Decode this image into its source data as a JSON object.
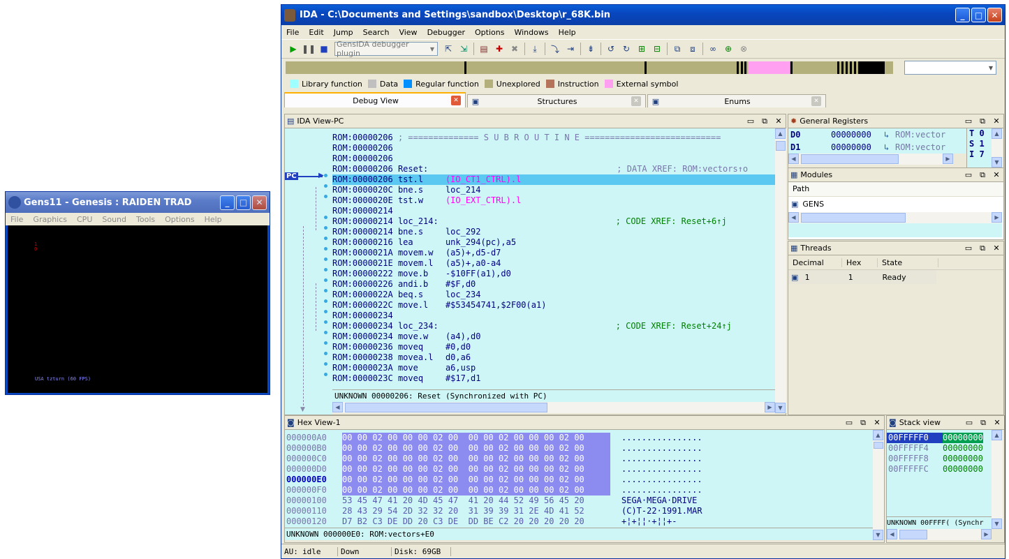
{
  "gens": {
    "title": "Gens11 - Genesis : RAIDEN TRAD",
    "menu": [
      "File",
      "Graphics",
      "CPU",
      "Sound",
      "Tools",
      "Options",
      "Help"
    ],
    "screen_text": "USA tzturn (60 FPS)",
    "sprite_text": "1\n0"
  },
  "ida": {
    "title": "IDA - C:\\Documents and Settings\\sandbox\\Desktop\\r_68K.bin",
    "menu": [
      "File",
      "Edit",
      "Jump",
      "Search",
      "View",
      "Debugger",
      "Options",
      "Windows",
      "Help"
    ],
    "debugger_select": "GensIDA debugger plugin",
    "legend": [
      {
        "label": "Library function",
        "color": "#a0ffff"
      },
      {
        "label": "Data",
        "color": "#c0c0c0"
      },
      {
        "label": "Regular function",
        "color": "#0090ff"
      },
      {
        "label": "Unexplored",
        "color": "#b3b07c"
      },
      {
        "label": "Instruction",
        "color": "#b4735a"
      },
      {
        "label": "External symbol",
        "color": "#ffa0f0"
      }
    ],
    "tabs": [
      {
        "label": "Debug View",
        "active": true
      },
      {
        "label": "Structures",
        "active": false
      },
      {
        "label": "Enums",
        "active": false
      }
    ],
    "idaview": {
      "title": "IDA View-PC",
      "pc_label": "PC",
      "status": "UNKNOWN 00000206: Reset (Synchronized with PC)",
      "lines": [
        {
          "a": "ROM:00000206",
          "m": "; ============== S U B R O U T I N E ===========================",
          "o": "",
          "c": ""
        },
        {
          "a": "ROM:00000206",
          "m": "",
          "o": "",
          "c": ""
        },
        {
          "a": "ROM:00000206",
          "m": "",
          "o": "",
          "c": ""
        },
        {
          "a": "ROM:00000206",
          "m": "Reset:",
          "o": "",
          "c": "; DATA XREF: ROM:vectors↑o"
        },
        {
          "a": "ROM:00000206",
          "m": "tst.l",
          "o": "(IO_CT1_CTRL).l",
          "c": ""
        },
        {
          "a": "ROM:0000020C",
          "m": "bne.s",
          "o": "loc_214",
          "c": ""
        },
        {
          "a": "ROM:0000020E",
          "m": "tst.w",
          "o": "(IO_EXT_CTRL).l",
          "c": ""
        },
        {
          "a": "ROM:00000214",
          "m": "",
          "o": "",
          "c": ""
        },
        {
          "a": "ROM:00000214",
          "m": "loc_214:",
          "o": "",
          "c": "; CODE XREF: Reset+6↑j"
        },
        {
          "a": "ROM:00000214",
          "m": "bne.s",
          "o": "loc_292",
          "c": ""
        },
        {
          "a": "ROM:00000216",
          "m": "lea",
          "o": "unk_294(pc),a5",
          "c": ""
        },
        {
          "a": "ROM:0000021A",
          "m": "movem.w",
          "o": "(a5)+,d5-d7",
          "c": ""
        },
        {
          "a": "ROM:0000021E",
          "m": "movem.l",
          "o": "(a5)+,a0-a4",
          "c": ""
        },
        {
          "a": "ROM:00000222",
          "m": "move.b",
          "o": "-$10FF(a1),d0",
          "c": ""
        },
        {
          "a": "ROM:00000226",
          "m": "andi.b",
          "o": "#$F,d0",
          "c": ""
        },
        {
          "a": "ROM:0000022A",
          "m": "beq.s",
          "o": "loc_234",
          "c": ""
        },
        {
          "a": "ROM:0000022C",
          "m": "move.l",
          "o": "#$53454741,$2F00(a1)",
          "c": ""
        },
        {
          "a": "ROM:00000234",
          "m": "",
          "o": "",
          "c": ""
        },
        {
          "a": "ROM:00000234",
          "m": "loc_234:",
          "o": "",
          "c": "; CODE XREF: Reset+24↑j"
        },
        {
          "a": "ROM:00000234",
          "m": "move.w",
          "o": "(a4),d0",
          "c": ""
        },
        {
          "a": "ROM:00000236",
          "m": "moveq",
          "o": "#0,d0",
          "c": ""
        },
        {
          "a": "ROM:00000238",
          "m": "movea.l",
          "o": "d0,a6",
          "c": ""
        },
        {
          "a": "ROM:0000023A",
          "m": "move",
          "o": "a6,usp",
          "c": ""
        },
        {
          "a": "ROM:0000023C",
          "m": "moveq",
          "o": "#$17,d1",
          "c": ""
        }
      ]
    },
    "registers": {
      "title": "General Registers",
      "rows": [
        {
          "name": "D0",
          "value": "00000000",
          "ref": "ROM:vector"
        },
        {
          "name": "D1",
          "value": "00000000",
          "ref": "ROM:vector"
        }
      ],
      "flags": [
        "T 0",
        "S 1",
        "I 7"
      ]
    },
    "modules": {
      "title": "Modules",
      "col": "Path",
      "item": "GENS"
    },
    "threads": {
      "title": "Threads",
      "cols": [
        "Decimal",
        "Hex",
        "State"
      ],
      "row": [
        "1",
        "1",
        "Ready"
      ]
    },
    "hex": {
      "title": "Hex View-1",
      "status": "UNKNOWN 000000E0: ROM:vectors+E0",
      "rows": [
        {
          "a": "000000A0",
          "b": "00 00 02 00 00 00 02 00  00 00 02 00 00 00 02 00",
          "t": "................",
          "sel": true
        },
        {
          "a": "000000B0",
          "b": "00 00 02 00 00 00 02 00  00 00 02 00 00 00 02 00",
          "t": "................",
          "sel": true
        },
        {
          "a": "000000C0",
          "b": "00 00 02 00 00 00 02 00  00 00 02 00 00 00 02 00",
          "t": "................",
          "sel": true
        },
        {
          "a": "000000D0",
          "b": "00 00 02 00 00 00 02 00  00 00 02 00 00 00 02 00",
          "t": "................",
          "sel": true
        },
        {
          "a": "000000E0",
          "b": "00 00 02 00 00 00 02 00  00 00 02 00 00 00 02 00",
          "t": "................",
          "sel": true
        },
        {
          "a": "000000F0",
          "b": "00 00 02 00 00 00 02 00  00 00 02 00 00 00 02 00",
          "t": "................",
          "sel": true
        },
        {
          "a": "00000100",
          "b": "53 45 47 41 20 4D 45 47  41 20 44 52 49 56 45 20",
          "t": "SEGA·MEGA·DRIVE ",
          "sel": false
        },
        {
          "a": "00000110",
          "b": "28 43 29 54 2D 32 32 20  31 39 39 31 2E 4D 41 52",
          "t": "(C)T-22·1991.MAR",
          "sel": false
        },
        {
          "a": "00000120",
          "b": "D7 B2 C3 DE DD 20 C3 DE  DD BE C2 20 20 20 20 20",
          "t": "+¦+¦¦·+¦¦+-",
          "sel": false
        }
      ]
    },
    "stack": {
      "title": "Stack view",
      "status": "UNKNOWN 00FFFF( (Synchr",
      "rows": [
        {
          "a": "00FFFFF0",
          "v": "00000000"
        },
        {
          "a": "00FFFFF4",
          "v": "00000000"
        },
        {
          "a": "00FFFFF8",
          "v": "00000000"
        },
        {
          "a": "00FFFFFC",
          "v": "00000000"
        }
      ]
    },
    "statusbar": {
      "au": "AU:",
      "state": "idle",
      "dir": "Down",
      "disk": "Disk: 69GB"
    }
  }
}
